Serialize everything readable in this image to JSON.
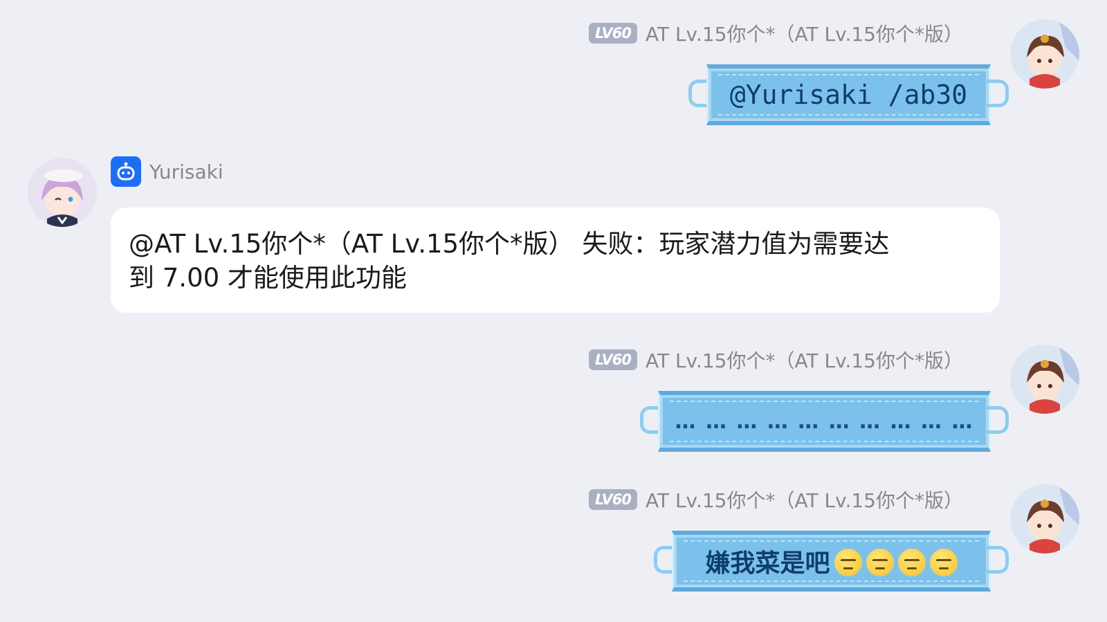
{
  "messages": [
    {
      "sender": {
        "level_badge": "LV60",
        "name": "AT Lv.15你个*（AT Lv.15你个*版）"
      },
      "text": "@Yurisaki /ab30"
    },
    {
      "sender": {
        "name": "Yurisaki"
      },
      "text_line1": "@AT Lv.15你个*（AT Lv.15你个*版） 失败：玩家潜力值为需要达",
      "text_line2": "到 7.00 才能使用此功能"
    },
    {
      "sender": {
        "level_badge": "LV60",
        "name": "AT Lv.15你个*（AT Lv.15你个*版）"
      },
      "text": "… … … … … … … … … …"
    },
    {
      "sender": {
        "level_badge": "LV60",
        "name": "AT Lv.15你个*（AT Lv.15你个*版）"
      },
      "text": "嫌我菜是吧",
      "emoji": "unamused-face-icon",
      "emoji_count": 4
    }
  ],
  "colors": {
    "background": "#eeeff4",
    "mask_blue": "#7cc1ec",
    "bot_blue": "#1e6ef5",
    "level_badge": "#a9b0c3"
  }
}
